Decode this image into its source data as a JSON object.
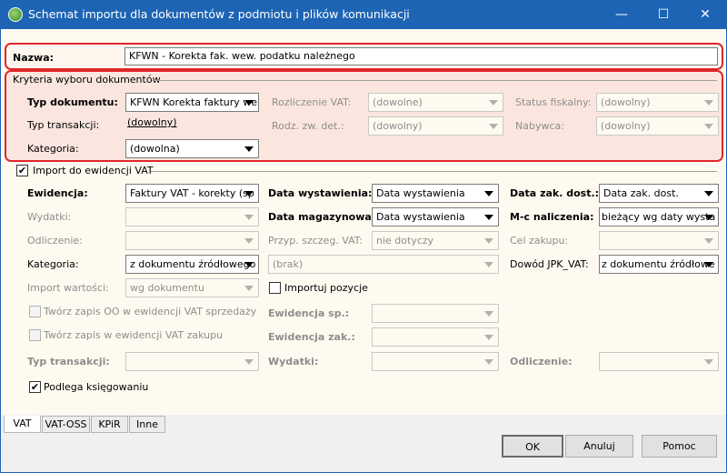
{
  "window": {
    "title": "Schemat importu dla dokumentów z podmiotu i plików komunikacji",
    "minimize": "—",
    "maximize": "☐",
    "close": "✕"
  },
  "nazwa": {
    "label": "Nazwa:",
    "value": "KFWN - Korekta fak. wew. podatku należnego"
  },
  "kryteria": {
    "legend": "Kryteria wyboru dokumentów",
    "typ_dokumentu": {
      "label": "Typ dokumentu:",
      "value": "KFWN Korekta faktury we"
    },
    "typ_transakcji": {
      "label": "Typ transakcji:",
      "value": "(dowolny)"
    },
    "kategoria": {
      "label": "Kategoria:",
      "value": "(dowolna)"
    },
    "rozliczenie_vat": {
      "label": "Rozliczenie VAT:",
      "value": "(dowolne)"
    },
    "rodz_zw_det": {
      "label": "Rodz. zw. det.:",
      "value": "(dowolny)"
    },
    "status_fiskalny": {
      "label": "Status fiskalny:",
      "value": "(dowolny)"
    },
    "nabywca": {
      "label": "Nabywca:",
      "value": "(dowolny)"
    }
  },
  "import_vat": {
    "label": "Import do ewidencji VAT",
    "checked": true,
    "ewidencja": {
      "label": "Ewidencja:",
      "value": "Faktury VAT - korekty (sp"
    },
    "wydatki": {
      "label": "Wydatki:",
      "value": ""
    },
    "odliczenie": {
      "label": "Odliczenie:",
      "value": ""
    },
    "kategoria": {
      "label": "Kategoria:",
      "value": "z dokumentu źródłowego"
    },
    "import_wartosci": {
      "label": "Import wartości:",
      "value": "wg dokumentu"
    },
    "data_wystawienia": {
      "label": "Data wystawienia:",
      "value": "Data wystawienia"
    },
    "data_magazynowa": {
      "label": "Data magazynowa:",
      "value": "Data wystawienia"
    },
    "przyp_szczeg_vat": {
      "label": "Przyp. szczeg. VAT:",
      "value": "nie dotyczy"
    },
    "brak": {
      "value": "(brak)"
    },
    "importuj_pozycje": {
      "label": "Importuj pozycje",
      "checked": false
    },
    "data_zak_dost": {
      "label": "Data zak. dost.:",
      "value": "Data zak. dost."
    },
    "mc_naliczenia": {
      "label": "M-c naliczenia:",
      "value": "bieżący wg daty wysta"
    },
    "cel_zakupu": {
      "label": "Cel zakupu:",
      "value": ""
    },
    "dowod_jpk": {
      "label": "Dowód JPK_VAT:",
      "value": "z dokumentu źródłowe"
    },
    "zapis_oo": {
      "label": "Twórz zapis OO w ewidencji VAT sprzedaży",
      "checked": false
    },
    "zapis_zakupu": {
      "label": "Twórz zapis w ewidencji VAT zakupu",
      "checked": false
    },
    "ewidencja_sp": {
      "label": "Ewidencja sp.:",
      "value": ""
    },
    "ewidencja_zak": {
      "label": "Ewidencja zak.:",
      "value": ""
    },
    "typ_transakcji2": {
      "label": "Typ transakcji:",
      "value": ""
    },
    "wydatki2": {
      "label": "Wydatki:",
      "value": ""
    },
    "odliczenie2": {
      "label": "Odliczenie:",
      "value": ""
    },
    "podlega": {
      "label": "Podlega księgowaniu",
      "checked": true
    }
  },
  "tabs": [
    "VAT",
    "VAT-OSS",
    "KPiR",
    "Inne"
  ],
  "buttons": {
    "ok": "OK",
    "cancel": "Anuluj",
    "help": "Pomoc"
  }
}
